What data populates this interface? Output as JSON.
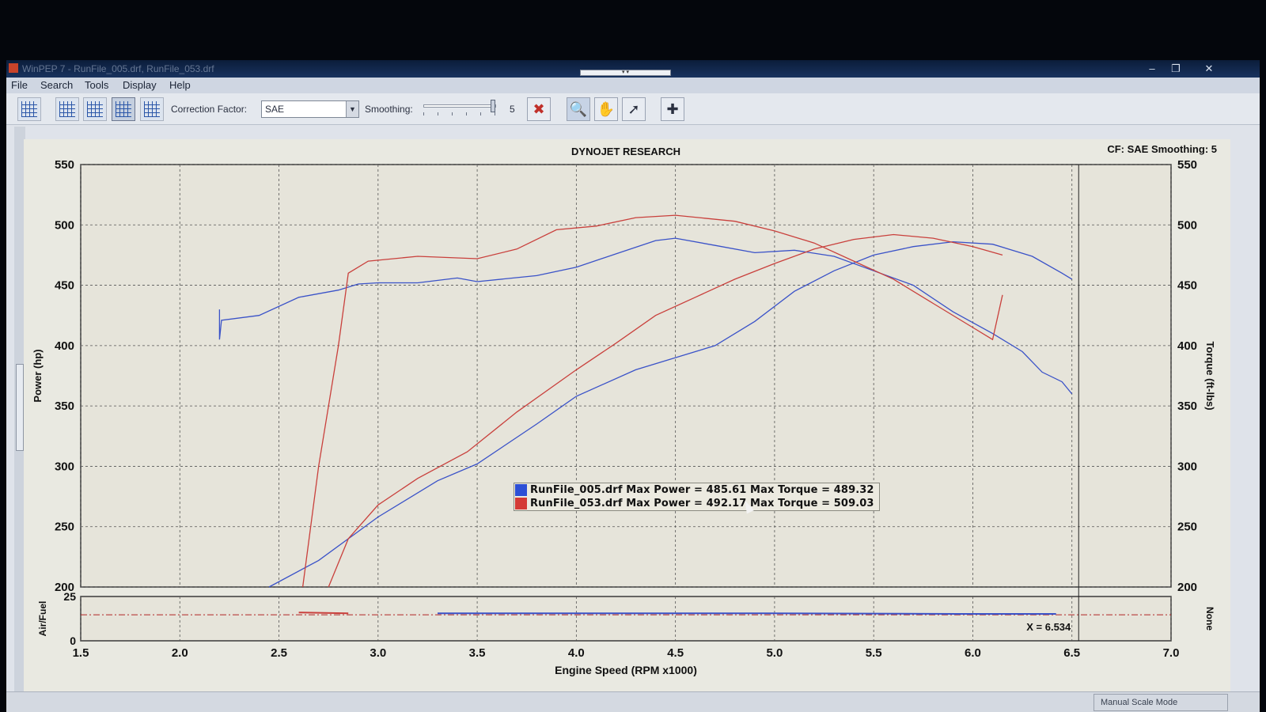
{
  "window": {
    "title": "WinPEP 7 - RunFile_005.drf, RunFile_053.drf",
    "controls": {
      "minimize": "–",
      "maximize": "❐",
      "close": "✕"
    }
  },
  "menu": [
    "File",
    "Search",
    "Tools",
    "Display",
    "Help"
  ],
  "toolbar": {
    "correction_factor_label": "Correction Factor:",
    "correction_factor_value": "SAE",
    "smoothing_label": "Smoothing:",
    "smoothing_value": "5"
  },
  "graph_header": {
    "title": "DYNOJET RESEARCH",
    "cf_info": "CF: SAE  Smoothing: 5"
  },
  "legend": [
    {
      "text": "RunFile_005.drf Max Power = 485.61 Max Torque = 489.32",
      "color": "#2d4fd6"
    },
    {
      "text": "RunFile_053.drf Max Power = 492.17 Max Torque = 509.03",
      "color": "#d43a36"
    }
  ],
  "cursor_readout": "X = 6.534",
  "statusbar": {
    "mode": "Manual Scale Mode"
  },
  "chart_data": [
    {
      "type": "line",
      "title": "DYNOJET RESEARCH",
      "xlabel": "Engine Speed (RPM x1000)",
      "ylabel": "Power (hp)",
      "y2label": "Torque (ft-lbs)",
      "xlim": [
        1.5,
        7.0
      ],
      "ylim": [
        200,
        550
      ],
      "y2lim": [
        200,
        550
      ],
      "x_ticks": [
        "1.5",
        "2.0",
        "2.5",
        "3.0",
        "3.5",
        "4.0",
        "4.5",
        "5.0",
        "5.5",
        "6.0",
        "6.5",
        "7.0"
      ],
      "y_ticks": [
        "200",
        "250",
        "300",
        "350",
        "400",
        "450",
        "500",
        "550"
      ],
      "y2_ticks": [
        "200",
        "250",
        "300",
        "350",
        "400",
        "450",
        "500",
        "550"
      ],
      "grid": true,
      "cursor_x": 6.534,
      "series": [
        {
          "name": "RunFile_005.drf",
          "measure": "Power",
          "color": "#3a52c8",
          "points": [
            [
              2.45,
              200
            ],
            [
              2.7,
              222
            ],
            [
              3.0,
              258
            ],
            [
              3.3,
              288
            ],
            [
              3.5,
              302
            ],
            [
              3.8,
              335
            ],
            [
              4.0,
              358
            ],
            [
              4.3,
              380
            ],
            [
              4.5,
              390
            ],
            [
              4.7,
              400
            ],
            [
              4.9,
              420
            ],
            [
              5.1,
              445
            ],
            [
              5.3,
              462
            ],
            [
              5.5,
              475
            ],
            [
              5.7,
              482
            ],
            [
              5.9,
              486
            ],
            [
              6.1,
              484
            ],
            [
              6.3,
              474
            ],
            [
              6.45,
              460
            ],
            [
              6.5,
              455
            ]
          ]
        },
        {
          "name": "RunFile_005.drf",
          "measure": "Torque",
          "color": "#3a52c8",
          "points": [
            [
              2.2,
              430
            ],
            [
              2.2,
              405
            ],
            [
              2.21,
              421
            ],
            [
              2.4,
              425
            ],
            [
              2.6,
              440
            ],
            [
              2.8,
              446
            ],
            [
              2.9,
              451
            ],
            [
              3.0,
              452
            ],
            [
              3.2,
              452
            ],
            [
              3.4,
              456
            ],
            [
              3.5,
              453
            ],
            [
              3.8,
              458
            ],
            [
              4.0,
              465
            ],
            [
              4.2,
              476
            ],
            [
              4.4,
              487
            ],
            [
              4.5,
              489
            ],
            [
              4.7,
              483
            ],
            [
              4.9,
              477
            ],
            [
              5.1,
              479
            ],
            [
              5.3,
              474
            ],
            [
              5.5,
              462
            ],
            [
              5.7,
              450
            ],
            [
              5.9,
              428
            ],
            [
              6.1,
              410
            ],
            [
              6.25,
              395
            ],
            [
              6.35,
              378
            ],
            [
              6.45,
              370
            ],
            [
              6.5,
              360
            ]
          ]
        },
        {
          "name": "RunFile_053.drf",
          "measure": "Power",
          "color": "#c9403c",
          "points": [
            [
              2.75,
              200
            ],
            [
              2.85,
              240
            ],
            [
              3.0,
              268
            ],
            [
              3.2,
              290
            ],
            [
              3.45,
              312
            ],
            [
              3.7,
              345
            ],
            [
              4.0,
              380
            ],
            [
              4.2,
              402
            ],
            [
              4.4,
              425
            ],
            [
              4.6,
              440
            ],
            [
              4.8,
              455
            ],
            [
              5.0,
              468
            ],
            [
              5.2,
              480
            ],
            [
              5.4,
              488
            ],
            [
              5.6,
              492
            ],
            [
              5.8,
              489
            ],
            [
              6.0,
              482
            ],
            [
              6.15,
              475
            ]
          ]
        },
        {
          "name": "RunFile_053.drf",
          "measure": "Torque",
          "color": "#c9403c",
          "points": [
            [
              2.62,
              200
            ],
            [
              2.7,
              300
            ],
            [
              2.8,
              400
            ],
            [
              2.85,
              460
            ],
            [
              2.95,
              470
            ],
            [
              3.2,
              474
            ],
            [
              3.5,
              472
            ],
            [
              3.7,
              480
            ],
            [
              3.9,
              496
            ],
            [
              4.1,
              499
            ],
            [
              4.3,
              506
            ],
            [
              4.5,
              508
            ],
            [
              4.8,
              503
            ],
            [
              5.0,
              495
            ],
            [
              5.2,
              485
            ],
            [
              5.4,
              470
            ],
            [
              5.6,
              455
            ],
            [
              5.8,
              435
            ],
            [
              6.0,
              415
            ],
            [
              6.1,
              405
            ],
            [
              6.15,
              442
            ]
          ]
        },
        {
          "name": "RunFile_005.drf",
          "measure": "Air/Fuel",
          "axis": "afr",
          "color": "#3a52c8",
          "points": [
            [
              3.3,
              15.5
            ],
            [
              3.5,
              15.5
            ],
            [
              3.55,
              15.5
            ],
            [
              4.98,
              15.5
            ],
            [
              5.92,
              15.2
            ],
            [
              6.1,
              15.2
            ],
            [
              6.25,
              15.2
            ],
            [
              6.42,
              15.2
            ]
          ]
        },
        {
          "name": "RunFile_053.drf",
          "measure": "Air/Fuel",
          "axis": "afr",
          "color": "#c9403c",
          "points": [
            [
              2.6,
              16.0
            ],
            [
              2.85,
              15.5
            ]
          ]
        }
      ]
    },
    {
      "type": "line",
      "ylabel": "Air/Fuel",
      "y2label": "None",
      "ylim": [
        0,
        25
      ],
      "y_ticks": [
        "0",
        "25"
      ],
      "reference_line": 14.7
    }
  ]
}
